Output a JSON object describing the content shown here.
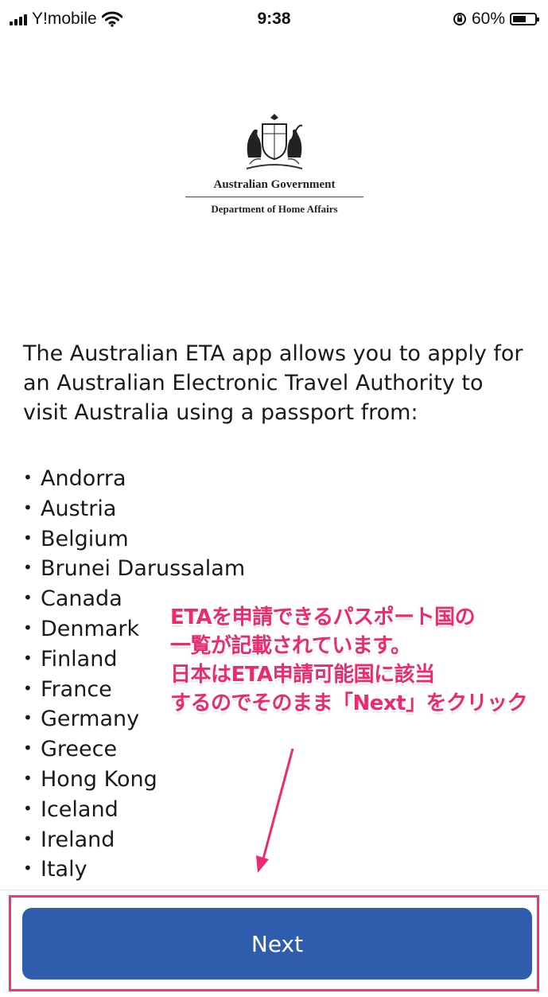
{
  "status_bar": {
    "carrier": "Y!mobile",
    "time": "9:38",
    "battery_percent": "60%",
    "battery_level": 0.6,
    "icons": [
      "signal-icon",
      "wifi-icon",
      "orientation-lock-icon",
      "battery-icon"
    ]
  },
  "logo": {
    "line1": "Australian Government",
    "line2": "Department of Home Affairs"
  },
  "intro_text": "The Australian ETA app allows you to apply for an Australian Electronic Travel Authority to visit Australia using a passport from:",
  "countries": [
    "Andorra",
    "Austria",
    "Belgium",
    "Brunei Darussalam",
    "Canada",
    "Denmark",
    "Finland",
    "France",
    "Germany",
    "Greece",
    "Hong Kong",
    "Iceland",
    "Ireland",
    "Italy"
  ],
  "annotation": {
    "lines": [
      "ETAを申請できるパスポート国の",
      "一覧が記載されています。",
      "日本はETA申請可能国に該当",
      "するのでそのまま「Next」をクリック"
    ],
    "color": "#ec2a6d"
  },
  "next_button": {
    "label": "Next",
    "color": "#2f5dae"
  }
}
